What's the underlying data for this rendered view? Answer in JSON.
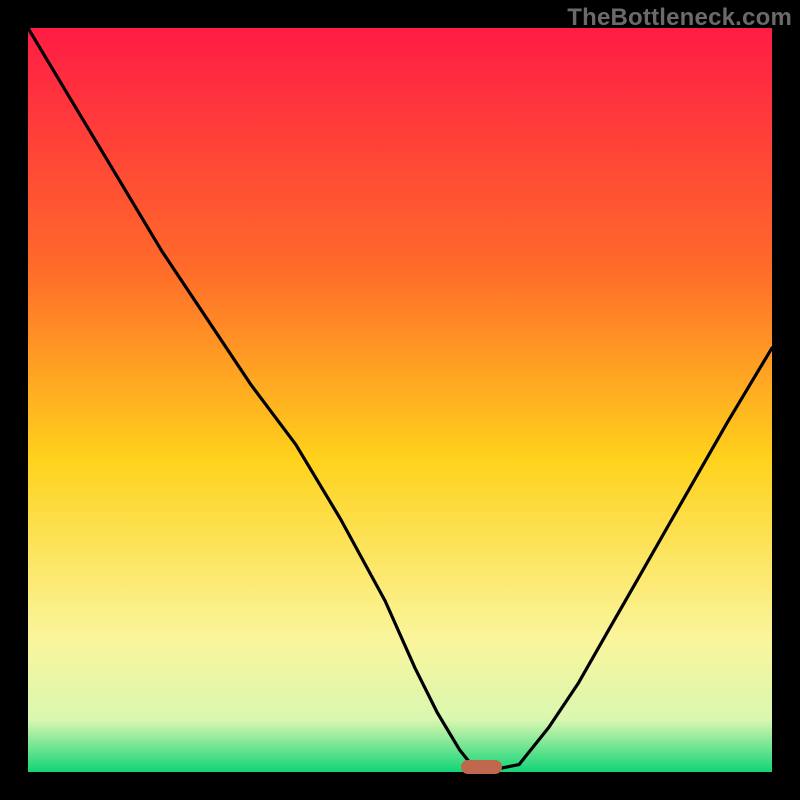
{
  "attribution": "TheBottleneck.com",
  "chart_data": {
    "type": "line",
    "title": "",
    "xlabel": "",
    "ylabel": "",
    "xlim": [
      0,
      100
    ],
    "ylim": [
      0,
      100
    ],
    "x": [
      0,
      6,
      12,
      18,
      24,
      30,
      36,
      42,
      48,
      52,
      55,
      58,
      60,
      63,
      66,
      70,
      74,
      78,
      82,
      86,
      90,
      94,
      100
    ],
    "values": [
      100,
      90,
      80,
      70,
      61,
      52,
      44,
      34,
      23,
      14,
      8,
      3,
      0.5,
      0.4,
      1,
      6,
      12,
      19,
      26,
      33,
      40,
      47,
      57
    ],
    "optimum_x": 61.5,
    "gradient_colors": {
      "top": "#ff1c45",
      "upper_mid": "#ff6a2a",
      "mid": "#ffd21c",
      "lower_mid": "#faf59c",
      "near_bottom": "#d9f7b0",
      "bottom": "#11d477"
    },
    "marker": {
      "x_frac": 0.61,
      "width_frac": 0.055,
      "color": "#c0684e"
    }
  }
}
